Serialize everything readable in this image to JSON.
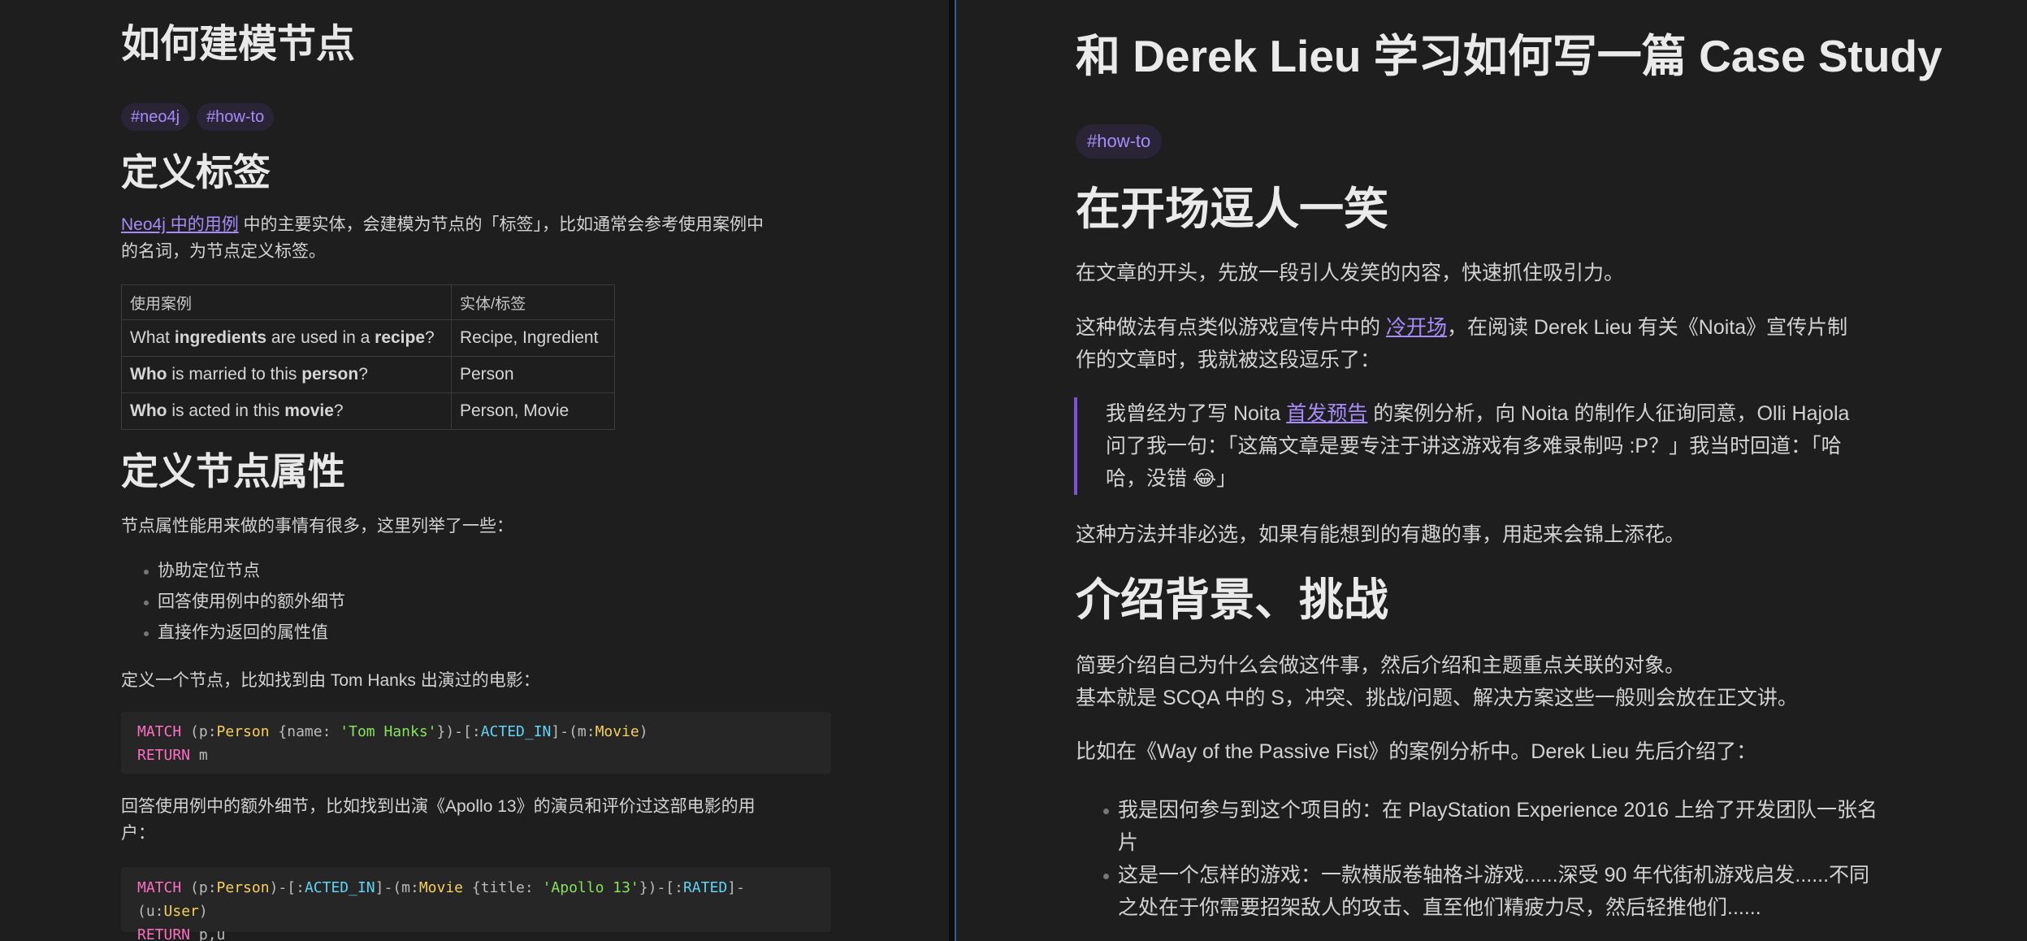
{
  "left": {
    "title": "如何建模节点",
    "tags": [
      "#neo4j",
      "#how-to"
    ],
    "section1": {
      "heading": "定义标签",
      "link_text": "Neo4j 中的用例",
      "para_rest_line1": " 中的主要实体，会建模为节点的「标签」，比如通常会参考使用案例中",
      "para_line2": "的名词，为节点定义标签。",
      "table": {
        "headers": [
          "使用案例",
          "实体/标签"
        ],
        "rows": [
          {
            "c1a": "What ",
            "c1b": "ingredients",
            "c1c": " are used in a ",
            "c1d": "recipe",
            "c1e": "?",
            "c2": "Recipe, Ingredient"
          },
          {
            "c1a": "",
            "c1b": "Who",
            "c1c": " is married to this ",
            "c1d": "person",
            "c1e": "?",
            "c2": "Person"
          },
          {
            "c1a": "",
            "c1b": "Who",
            "c1c": " is acted in this ",
            "c1d": "movie",
            "c1e": "?",
            "c2": "Person, Movie"
          }
        ]
      }
    },
    "section2": {
      "heading": "定义节点属性",
      "intro": "节点属性能用来做的事情有很多，这里列举了一些：",
      "bullets": [
        "协助定位节点",
        "回答使用例中的额外细节",
        "直接作为返回的属性值"
      ],
      "para_find": "定义一个节点，比如找到由 Tom Hanks 出演过的电影：",
      "code1": {
        "line1": {
          "t1": "MATCH",
          "t2": " (p:",
          "t3": "Person",
          "t4": " {name: ",
          "t5": "'Tom Hanks'",
          "t6": "})-[:",
          "t7": "ACTED_IN",
          "t8": "]-(m:",
          "t9": "Movie",
          "t10": ")"
        },
        "line2": {
          "t1": "RETURN",
          "t2": " m"
        }
      },
      "para_extra_line1": "回答使用例中的额外细节，比如找到出演《Apollo 13》的演员和评价过这部电影的用",
      "para_extra_line2": "户：",
      "code2": {
        "line1": {
          "t1": "MATCH",
          "t2": " (p:",
          "t3": "Person",
          "t4": ")-[:",
          "t5": "ACTED_IN",
          "t6": "]-(m:",
          "t7": "Movie",
          "t8": " {title: ",
          "t9": "'Apollo 13'",
          "t10": "})-[:",
          "t11": "RATED",
          "t12": "]-(u:",
          "t13": "User",
          "t14": ")"
        },
        "line2": {
          "t1": "RETURN",
          "t2": " p,u"
        }
      }
    }
  },
  "right": {
    "title": "和 Derek Lieu 学习如何写一篇 Case Study",
    "tag": "#how-to",
    "section1": {
      "heading": "在开场逗人一笑",
      "p1": "在文章的开头，先放一段引人发笑的内容，快速抓住吸引力。",
      "p2_a": "这种做法有点类似游戏宣传片中的 ",
      "p2_link": "冷开场",
      "p2_b": "，在阅读 Derek Lieu 有关《Noita》宣传片制",
      "p2_line2": "作的文章时，我就被这段逗乐了：",
      "quote_a": "我曾经为了写 Noita ",
      "quote_link": "首发预告",
      "quote_b": " 的案例分析，向 Noita 的制作人征询同意，Olli Hajola",
      "quote_line2": "问了我一句：「这篇文章是要专注于讲这游戏有多难录制吗 :P？」我当时回道：「哈",
      "quote_line3": "哈，没错 😂」",
      "p3": "这种方法并非必选，如果有能想到的有趣的事，用起来会锦上添花。"
    },
    "section2": {
      "heading": "介绍背景、挑战",
      "p1_line1": "简要介绍自己为什么会做这件事，然后介绍和主题重点关联的对象。",
      "p1_line2": "基本就是 SCQA 中的 S，冲突、挑战/问题、解决方案这些一般则会放在正文讲。",
      "p2": "比如在《Way of the Passive Fist》的案例分析中。Derek Lieu 先后介绍了：",
      "bullets": [
        {
          "line1": "我是因何参与到这个项目的：在 PlayStation Experience 2016 上给了开发团队一张名",
          "line2": "片"
        },
        {
          "line1": "这是一个怎样的游戏：一款横版卷轴格斗游戏......深受 90 年代街机游戏启发......不同",
          "line2": "之处在于你需要招架敌人的攻击、直至他们精疲力尽，然后轻推他们......"
        }
      ]
    }
  },
  "colors": {
    "background": "#1e1e1e",
    "text": "#dcddde",
    "accent": "#a78bfa",
    "quote_border": "#7b52d8",
    "divider_active": "#2f5d9a"
  }
}
